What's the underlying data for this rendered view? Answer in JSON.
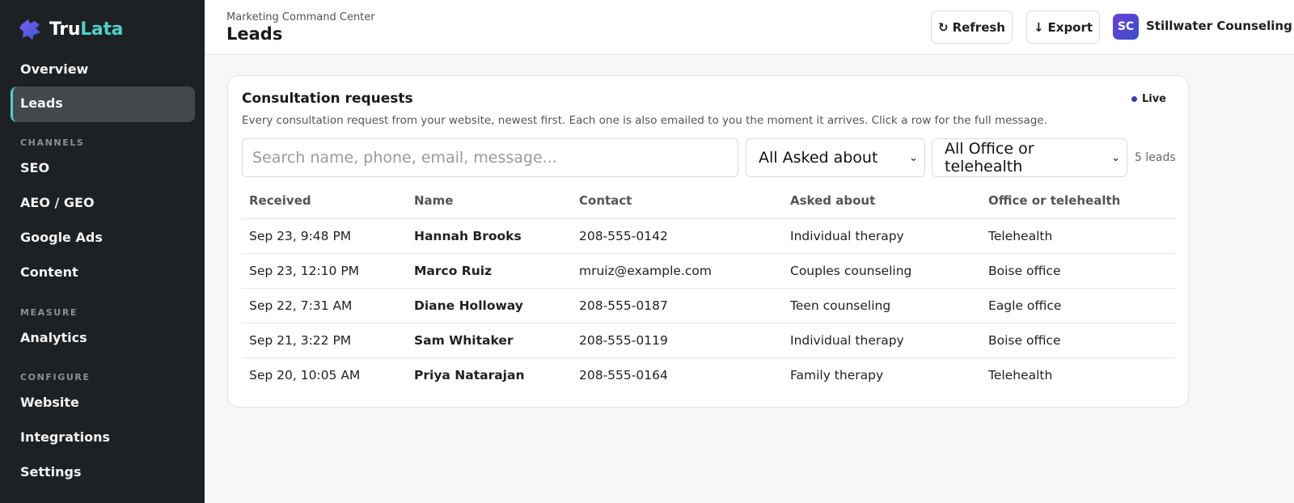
{
  "brand": {
    "part1": "Tru",
    "part2": "Lata"
  },
  "sidebar": {
    "overview": "Overview",
    "leads": "Leads",
    "section_channels": "CHANNELS",
    "seo": "SEO",
    "aeo": "AEO / GEO",
    "google_ads": "Google Ads",
    "content": "Content",
    "section_measure": "MEASURE",
    "analytics": "Analytics",
    "section_configure": "CONFIGURE",
    "website": "Website",
    "integrations": "Integrations",
    "settings": "Settings"
  },
  "header": {
    "breadcrumb": "Marketing Command Center",
    "title": "Leads",
    "refresh_label": "Refresh",
    "export_label": "Export",
    "avatar_initials": "SC",
    "account_name": "Stillwater Counseling"
  },
  "card": {
    "title": "Consultation requests",
    "description": "Every consultation request from your website, newest first. Each one is also emailed to you the moment it arrives. Click a row for the full message.",
    "live_label": "Live",
    "search_placeholder": "Search name, phone, email, message...",
    "asked_filter": "All Asked about",
    "office_filter": "All Office or telehealth",
    "lead_count": "5 leads"
  },
  "table": {
    "headers": [
      "Received",
      "Name",
      "Contact",
      "Asked about",
      "Office or telehealth"
    ],
    "rows": [
      [
        "Sep 23, 9:48 PM",
        "Hannah Brooks",
        "208-555-0142",
        "Individual therapy",
        "Telehealth"
      ],
      [
        "Sep 23, 12:10 PM",
        "Marco Ruiz",
        "mruiz@example.com",
        "Couples counseling",
        "Boise office"
      ],
      [
        "Sep 22, 7:31 AM",
        "Diane Holloway",
        "208-555-0187",
        "Teen counseling",
        "Eagle office"
      ],
      [
        "Sep 21, 3:22 PM",
        "Sam Whitaker",
        "208-555-0119",
        "Individual therapy",
        "Boise office"
      ],
      [
        "Sep 20, 10:05 AM",
        "Priya Natarajan",
        "208-555-0164",
        "Family therapy",
        "Telehealth"
      ]
    ]
  },
  "colors": {
    "sidebar_bg": "#1e2124",
    "accent_teal": "#4fd1c5",
    "live_dot": "#3b3fa5",
    "avatar_gradient_start": "#6a3fd8",
    "avatar_gradient_end": "#3b4fc8"
  },
  "icons": {
    "logo": "puzzle-logo-icon",
    "refresh": "refresh-icon",
    "export": "arrow-down-icon",
    "select": "chevron-down-icon",
    "live": "live-dot-icon"
  }
}
